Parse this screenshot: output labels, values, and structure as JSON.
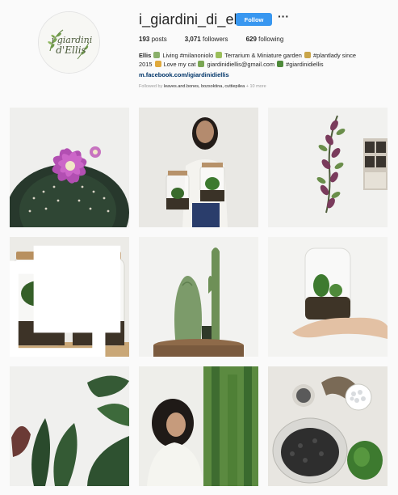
{
  "profile": {
    "avatar_text_line1": "i giardini",
    "avatar_text_line2": "d'Ellis",
    "username": "i_giardini_di_ellis",
    "follow_label": "Follow",
    "more_label": "···"
  },
  "stats": {
    "posts_count": "193",
    "posts_label": "posts",
    "followers_count": "3,071",
    "followers_label": "followers",
    "following_count": "629",
    "following_label": "following"
  },
  "bio": {
    "name": "Ellis",
    "line1_a": "Living #milanoniolo",
    "line1_b": "Terrarium & Miniature garden",
    "line1_c": "#plantlady since",
    "line2_a": "2015",
    "line2_b": "Love my cat",
    "line2_c": "giardinidiellis@gmail.com",
    "line2_d": "#giardinidiellis",
    "link": "m.facebook.com/igiardinidiellis",
    "followed_prefix": "Followed by",
    "followed_names": "leaves.and.bones, bozsoktina, cuttiepilea",
    "followed_more": "+ 10 more"
  },
  "grid": {
    "tiles": [
      {
        "name": "post-cactus-flower"
      },
      {
        "name": "post-woman-terrariums"
      },
      {
        "name": "post-hanging-plant"
      },
      {
        "name": "post-two-jar-terrariums"
      },
      {
        "name": "post-cactus-pot"
      },
      {
        "name": "post-hand-terrarium"
      },
      {
        "name": "post-rubber-plant"
      },
      {
        "name": "post-woman-plants"
      },
      {
        "name": "post-terrarium-supplies"
      }
    ]
  },
  "colors": {
    "accent": "#3897f0",
    "link": "#003569",
    "background": "#fafafa",
    "text": "#262626",
    "muted": "#999999"
  }
}
